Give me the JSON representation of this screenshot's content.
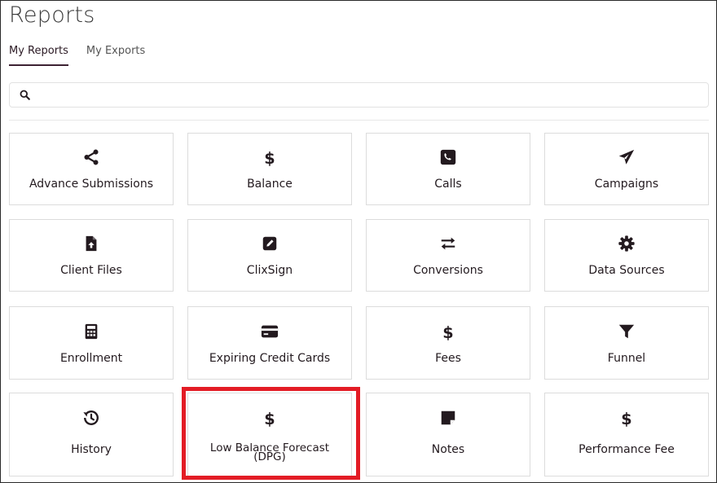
{
  "header": {
    "title": "Reports"
  },
  "tabs": [
    {
      "label": "My Reports",
      "active": true
    },
    {
      "label": "My Exports",
      "active": false
    }
  ],
  "search": {
    "value": "",
    "placeholder": "",
    "icon": "search-icon"
  },
  "cards": [
    {
      "label": "Advance Submissions",
      "icon": "share-icon"
    },
    {
      "label": "Balance",
      "icon": "dollar-icon"
    },
    {
      "label": "Calls",
      "icon": "phone-square-icon"
    },
    {
      "label": "Campaigns",
      "icon": "paper-plane-icon"
    },
    {
      "label": "Client Files",
      "icon": "file-upload-icon"
    },
    {
      "label": "ClixSign",
      "icon": "edit-square-icon"
    },
    {
      "label": "Conversions",
      "icon": "exchange-arrows-icon"
    },
    {
      "label": "Data Sources",
      "icon": "gear-icon"
    },
    {
      "label": "Enrollment",
      "icon": "calculator-icon"
    },
    {
      "label": "Expiring Credit Cards",
      "icon": "credit-card-icon"
    },
    {
      "label": "Fees",
      "icon": "dollar-icon"
    },
    {
      "label": "Funnel",
      "icon": "filter-icon"
    },
    {
      "label": "History",
      "icon": "history-icon"
    },
    {
      "label": "Low Balance Forecast",
      "label_line2": "(DPG)",
      "icon": "dollar-icon"
    },
    {
      "label": "Notes",
      "icon": "sticky-note-icon"
    },
    {
      "label": "Performance Fee",
      "icon": "dollar-icon"
    }
  ],
  "colors": {
    "icon": "#231a1f",
    "highlight": "#e31c25",
    "active_tab_underline": "#3d2233"
  }
}
